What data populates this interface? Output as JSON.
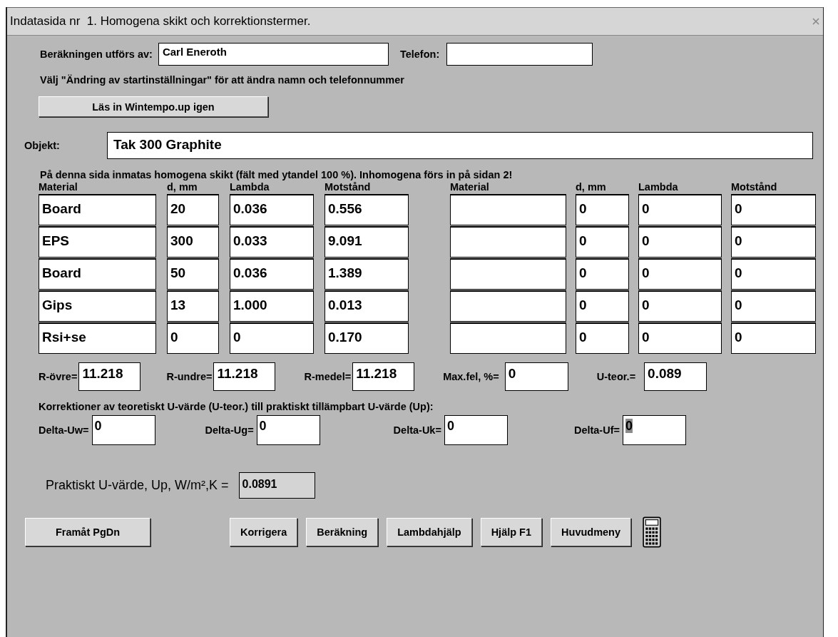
{
  "window": {
    "title": "Indatasida nr  1. Homogena skikt och korrektionstermer."
  },
  "author": {
    "label": "Beräkningen utförs av:",
    "value": "Carl Eneroth"
  },
  "phone": {
    "label": "Telefon:"
  },
  "note": "Välj \"Ändring av startinställningar\" för att ändra namn och telefonnummer",
  "reload_button": "Läs in Wintempo.up igen",
  "object": {
    "label": "Objekt:",
    "value": "Tak 300 Graphite"
  },
  "intro": "På denna sida inmatas homogena skikt (fält med ytandel 100 %).   Inhomogena förs in på sidan 2!",
  "tables": [
    {
      "columns": [
        "Material",
        "d, mm",
        "Lambda",
        "Motstånd"
      ],
      "rows": [
        [
          "Board",
          "20",
          "0.036",
          "0.556"
        ],
        [
          "EPS",
          "300",
          "0.033",
          "9.091"
        ],
        [
          "Board",
          "50",
          "0.036",
          "1.389"
        ],
        [
          "Gips",
          "13",
          "1.000",
          "0.013"
        ],
        [
          "Rsi+se",
          "0",
          "0",
          "0.170"
        ]
      ]
    },
    {
      "columns": [
        "Material",
        "d, mm",
        "Lambda",
        "Motstånd"
      ],
      "rows": [
        [
          null,
          "0",
          "0",
          "0"
        ],
        [
          null,
          "0",
          "0",
          "0"
        ],
        [
          null,
          "0",
          "0",
          "0"
        ],
        [
          null,
          "0",
          "0",
          "0"
        ],
        [
          null,
          "0",
          "0",
          "0"
        ]
      ]
    }
  ],
  "results": [
    {
      "label": "R-övre=",
      "value": "11.218"
    },
    {
      "label": "R-undre=",
      "value": "11.218"
    },
    {
      "label": "R-medel=",
      "value": "11.218"
    },
    {
      "label": "Max.fel, %=",
      "value": "0"
    },
    {
      "label": "U-teor.=",
      "value": "0.089"
    }
  ],
  "corrections": {
    "heading": "Korrektioner av teoretiskt U-värde (U-teor.) till praktiskt tillämpbart U-värde (Up):",
    "items": [
      {
        "label": "Delta-Uw=",
        "value": "0",
        "selected": false
      },
      {
        "label": "Delta-Ug=",
        "value": "0",
        "selected": false
      },
      {
        "label": "Delta-Uk=",
        "value": "0",
        "selected": false
      },
      {
        "label": "Delta-Uf=",
        "value": "0",
        "selected": true
      }
    ]
  },
  "practical": {
    "label": "Praktiskt U-värde, Up, W/m²,K =",
    "value": "0.0891"
  },
  "nav_buttons": [
    "Framåt PgDn"
  ],
  "action_buttons": [
    "Korrigera",
    "Beräkning",
    "Lambdahjälp",
    "Hjälp F1",
    "Huvudmeny"
  ]
}
